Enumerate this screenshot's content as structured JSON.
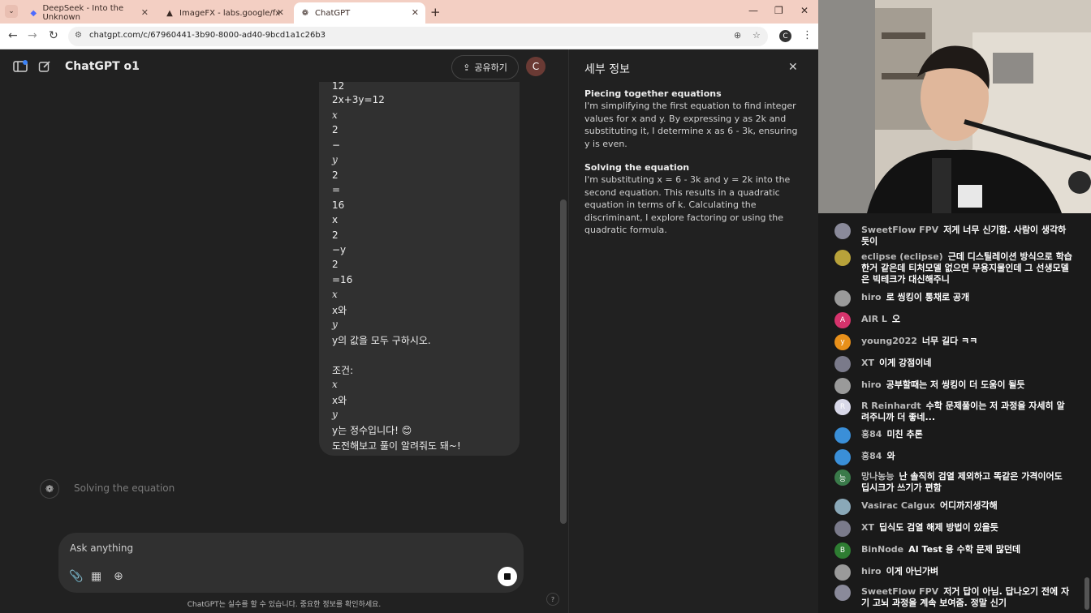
{
  "browser": {
    "tabs": [
      {
        "title": "DeepSeek - Into the Unknown",
        "icon": "deepseek-whale-icon"
      },
      {
        "title": "ImageFX - labs.google/fx",
        "icon": "labs-flask-icon"
      },
      {
        "title": "ChatGPT",
        "icon": "openai-icon"
      }
    ],
    "url": "chatgpt.com/c/67960441-3b90-8000-ad40-9bcd1a1c26b3",
    "profile_initial": "C"
  },
  "chatgpt": {
    "model_title": "ChatGPT o1",
    "share_label": "공유하기",
    "avatar_initial": "C",
    "user_message_lines": [
      {
        "text": "12",
        "italic": false
      },
      {
        "text": "2x+3y=12",
        "italic": false
      },
      {
        "text": "x",
        "italic": true
      },
      {
        "text": "2",
        "italic": false
      },
      {
        "text": "−",
        "italic": false
      },
      {
        "text": "y",
        "italic": true
      },
      {
        "text": "2",
        "italic": false
      },
      {
        "text": "=",
        "italic": false
      },
      {
        "text": "16",
        "italic": false
      },
      {
        "text": "x",
        "italic": false
      },
      {
        "text": "2",
        "italic": false
      },
      {
        "text": " −y",
        "italic": false
      },
      {
        "text": "2",
        "italic": false
      },
      {
        "text": " =16",
        "italic": false
      },
      {
        "text": "x",
        "italic": true
      },
      {
        "text": "x와",
        "italic": false
      },
      {
        "text": "y",
        "italic": true
      },
      {
        "text": "y의 값을 모두 구하시오.",
        "italic": false
      },
      {
        "text": "",
        "italic": false
      },
      {
        "text": "조건:",
        "italic": false
      },
      {
        "text": "x",
        "italic": true
      },
      {
        "text": "x와",
        "italic": false
      },
      {
        "text": "y",
        "italic": true
      },
      {
        "text": "y는 정수입니다! 😊",
        "italic": false
      },
      {
        "text": "도전해보고 풀이 알려줘도 돼~!",
        "italic": false
      }
    ],
    "thinking_status": "Solving the equation",
    "composer_placeholder": "Ask anything",
    "disclaimer": "ChatGPT는 실수를 할 수 있습니다. 중요한 정보를 확인하세요.",
    "help_label": "?"
  },
  "details_panel": {
    "title": "세부 정보",
    "sections": [
      {
        "heading": "Piecing together equations",
        "body": "I'm simplifying the first equation to find integer values for x and y. By expressing y as 2k and substituting it, I determine x as 6 - 3k, ensuring y is even."
      },
      {
        "heading": "Solving the equation",
        "body": "I'm substituting x = 6 - 3k and y = 2k into the second equation. This results in a quadratic equation in terms of k. Calculating the discriminant, I explore factoring or using the quadratic formula."
      }
    ]
  },
  "live_chat": {
    "messages": [
      {
        "name": "SweetFlow FPV",
        "text": "저게 너무 신기함. 사람이 생각하듯이",
        "avatar_color": "#8a8a9a",
        "initial": ""
      },
      {
        "name": "eclipse (eclipse)",
        "text": "근데 디스틸레이션 방식으로 학습한거 같은데 티처모델 없으면 무용지물인데 그 선생모델은 빅테크가 대신해주니",
        "avatar_color": "#b8a23a",
        "initial": ""
      },
      {
        "name": "hiro",
        "text": "로 씽킹이 통채로 공개",
        "avatar_color": "#9a9a9a",
        "initial": ""
      },
      {
        "name": "AIR L",
        "text": "오",
        "avatar_color": "#d6336c",
        "initial": "A"
      },
      {
        "name": "young2022",
        "text": "너무 길다 ㅋㅋ",
        "avatar_color": "#e8901a",
        "initial": "y"
      },
      {
        "name": "XT",
        "text": "이게 강점이네",
        "avatar_color": "#7a7a8a",
        "initial": ""
      },
      {
        "name": "hiro",
        "text": "공부할때는 저 씽킹이 더 도움이 될듯",
        "avatar_color": "#9a9a9a",
        "initial": ""
      },
      {
        "name": "R Reinhardt",
        "text": "수학 문제풀이는 저 과정을 자세히 알려주니까 더 좋네...",
        "avatar_color": "#d8d8e8",
        "initial": "R"
      },
      {
        "name": "홍84",
        "text": "미친 추론",
        "avatar_color": "#3a8fd8",
        "initial": ""
      },
      {
        "name": "홍84",
        "text": "와",
        "avatar_color": "#3a8fd8",
        "initial": ""
      },
      {
        "name": "망나농능",
        "text": "난 솔직히 검열 제외하고 똑같은 가격이어도 딥시크가 쓰기가 편함",
        "avatar_color": "#3a7a4a",
        "initial": "능"
      },
      {
        "name": "Vasirac Calgux",
        "text": "어디까지생각해",
        "avatar_color": "#8aa8b8",
        "initial": ""
      },
      {
        "name": "XT",
        "text": "딥식도 검열 해제 방법이 있을듯",
        "avatar_color": "#7a7a8a",
        "initial": ""
      },
      {
        "name": "BinNode",
        "text": "AI Test 용 수학 문제 많던데",
        "avatar_color": "#2e7d32",
        "initial": "B"
      },
      {
        "name": "hiro",
        "text": "이게 아닌가벼",
        "avatar_color": "#9a9a9a",
        "initial": ""
      },
      {
        "name": "SweetFlow FPV",
        "text": "저거 답이 아님. 답나오기 전에 자기 고뇌 과정을 계속 보여줌. 정말 신기",
        "avatar_color": "#8a8a9a",
        "initial": ""
      }
    ]
  }
}
